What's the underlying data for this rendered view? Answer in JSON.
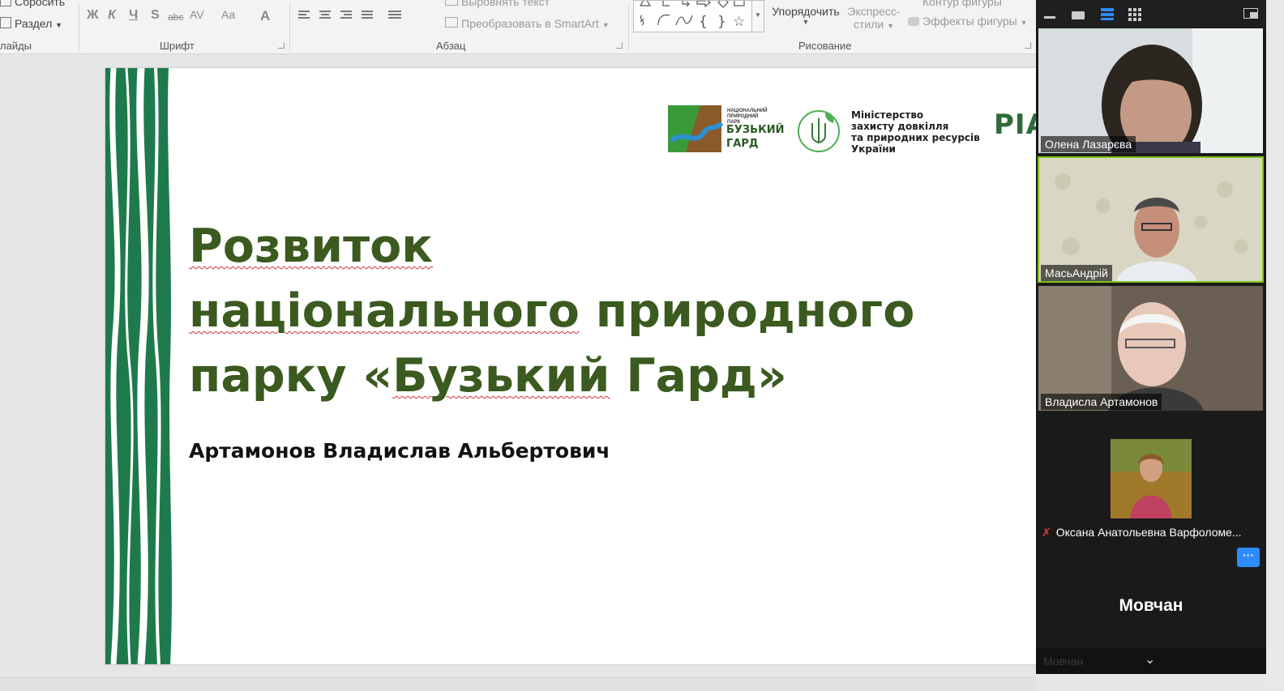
{
  "ribbon": {
    "reset_label": "Сбросить",
    "section_label": "Раздел",
    "slides_group": "лайды",
    "font_group": "Шрифт",
    "paragraph_group": "Абзац",
    "drawing_group": "Рисование",
    "align_text_label": "Выровнять текст",
    "smartart_label": "Преобразовать в SmartArt",
    "arrange_label": "Упорядочить",
    "quick_styles_label_1": "Экспресс-",
    "quick_styles_label_2": "стили",
    "shape_outline_label": "Контур фигуры",
    "shape_effects_label": "Эффекты фигуры",
    "format_bold": "Ж",
    "format_italic": "К",
    "format_underline": "Ч",
    "format_shadow": "S",
    "format_strike": "abc",
    "format_spacing": "AV",
    "format_case": "Aa",
    "font_color": "A"
  },
  "slide": {
    "title_line1": "Розвиток",
    "title_line2_word1": "національного",
    "title_line2_word2": " природного",
    "title_line3_word1": "парку «",
    "title_line3_word2": "Бузький",
    "title_line3_word3": " Гард»",
    "author": "Артамонов Владислав Альбертович",
    "park_logo_text_1": "НАЦІОНАЛЬНИЙ",
    "park_logo_text_2": "ПРИРОДНИЙ",
    "park_logo_text_3": "ПАРК",
    "park_logo_name_1": "БУЗЬКИЙ",
    "park_logo_name_2": "ГАРД",
    "ministry_line1": "Міністерство",
    "ministry_line2": "захисту довкілля",
    "ministry_line3": "та природних ресурсів",
    "ministry_line4": "України",
    "ria_logo": "РІА",
    "colors": {
      "title": "#3b5a1f",
      "stripe_green": "#1e7a4c"
    }
  },
  "zoom": {
    "participants": [
      {
        "name": "Олена Лазарєва"
      },
      {
        "name": "МасьАндрій"
      },
      {
        "name": "Владисла Артамонов"
      },
      {
        "name": "Оксана Анатольевна Варфоломе..."
      }
    ],
    "more_label": "···",
    "big_name": "Мовчан",
    "bottom_name": "Мовчан",
    "colors": {
      "active_speaker": "#7dc21e",
      "accent": "#2d8cff",
      "muted": "#e03c3c"
    }
  }
}
